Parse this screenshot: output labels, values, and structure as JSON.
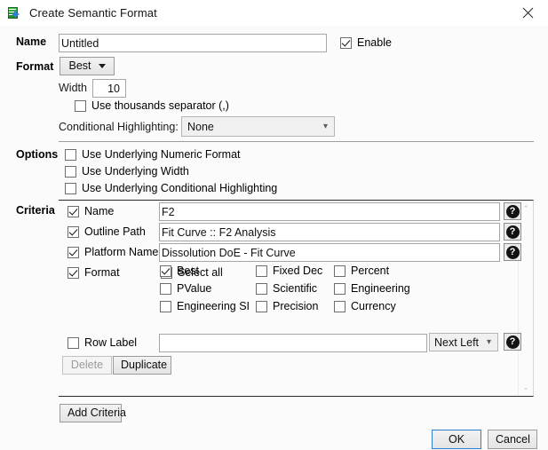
{
  "window": {
    "title": "Create Semantic Format",
    "icon": "semantic-format-icon",
    "close_label": "✕"
  },
  "name_row": {
    "label": "Name",
    "value": "Untitled",
    "placeholder": "",
    "enable_label": "Enable",
    "enable_checked": true
  },
  "format_row": {
    "label": "Format",
    "button_label": "Best",
    "width_label": "Width",
    "width_value": "10",
    "thousands_label": "Use thousands separator (,)",
    "thousands_checked": false,
    "cond_label": "Conditional Highlighting:",
    "cond_value": "None"
  },
  "options": {
    "label": "Options",
    "items": [
      {
        "label": "Use Underlying Numeric Format",
        "checked": false
      },
      {
        "label": "Use Underlying Width",
        "checked": false
      },
      {
        "label": "Use Underlying Conditional Highlighting",
        "checked": false
      }
    ]
  },
  "criteria": {
    "label": "Criteria",
    "rows": [
      {
        "label": "Name",
        "checked": true,
        "value": "F2",
        "help": "?"
      },
      {
        "label": "Outline Path",
        "checked": true,
        "value": "Fit Curve :: F2 Analysis",
        "help": "?"
      },
      {
        "label": "Platform Name",
        "checked": true,
        "value": "Dissolution DoE - Fit Curve",
        "help": "?"
      }
    ],
    "format": {
      "label": "Format",
      "checked": true,
      "select_all": {
        "label": "Select all",
        "checked": false
      },
      "options": [
        {
          "label": "Best",
          "checked": true
        },
        {
          "label": "Fixed Dec",
          "checked": false
        },
        {
          "label": "Percent",
          "checked": false
        },
        {
          "label": "PValue",
          "checked": false
        },
        {
          "label": "Scientific",
          "checked": false
        },
        {
          "label": "Engineering",
          "checked": false
        },
        {
          "label": "Engineering SI",
          "checked": false
        },
        {
          "label": "Precision",
          "checked": false
        },
        {
          "label": "Currency",
          "checked": false
        }
      ]
    },
    "row_label": {
      "label": "Row Label",
      "checked": false,
      "value": "",
      "position_value": "Next Left",
      "help": "?"
    },
    "delete_label": "Delete",
    "delete_enabled": false,
    "duplicate_label": "Duplicate",
    "scrollbar": {
      "up": "⌃",
      "down": "⌄"
    }
  },
  "footer": {
    "add_criteria_label": "Add Criteria",
    "ok_label": "OK",
    "cancel_label": "Cancel"
  },
  "colors": {
    "dialog_bg": "#fbfbfb",
    "titlebar_bg": "#ffffff",
    "accent_focus": "#2a7fd4",
    "icon_green": "#2f9e38",
    "icon_blue": "#2c7fd6"
  }
}
